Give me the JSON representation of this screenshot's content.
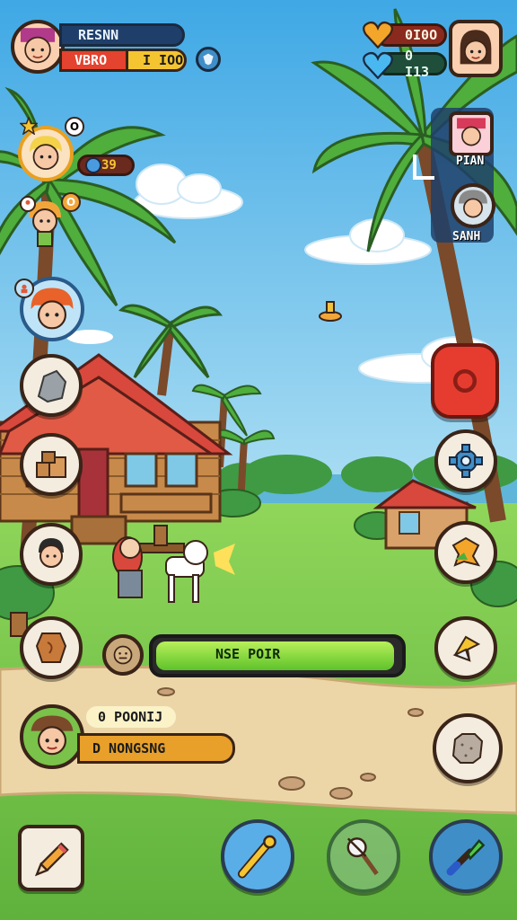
{
  "player": {
    "name": "RESNN",
    "sub_label": "VBRO",
    "currency": "I IOO"
  },
  "resources": {
    "hearts": "0I0O",
    "gems": "0 I13"
  },
  "left_party": {
    "member1_badge": "O",
    "gold_value": "39",
    "member2_badge": "O"
  },
  "right_party": {
    "member1_label": "PIAN",
    "member2_label": "SANH"
  },
  "progress": {
    "label": "NSE POIR",
    "fraction": 0.98
  },
  "quest": {
    "title": "0 POONIJ",
    "subtitle": "D NONGSNG"
  },
  "colors": {
    "sky_top": "#4aaee6",
    "sky_bottom": "#a8dcf2",
    "grass": "#7ccf4a",
    "path": "#ecd6a8",
    "progress_fill": "#79d82f",
    "gold_pill": "#f2b233",
    "currency_fill": "#f4c531",
    "dark_panel": "#1f3f6a",
    "roof": "#d8483c",
    "red_button": "#e53c2f"
  },
  "icons": {
    "left_menu": [
      "rock-icon",
      "crates-icon",
      "villager-icon",
      "leather-icon"
    ],
    "right_menu": [
      "gear-icon",
      "map-piece-icon",
      "shape-icon",
      "stone-block-icon"
    ],
    "bottom_bar": [
      "pencil-icon",
      "paintbrush-icon",
      "pickaxe-icon",
      "trowel-icon"
    ]
  }
}
